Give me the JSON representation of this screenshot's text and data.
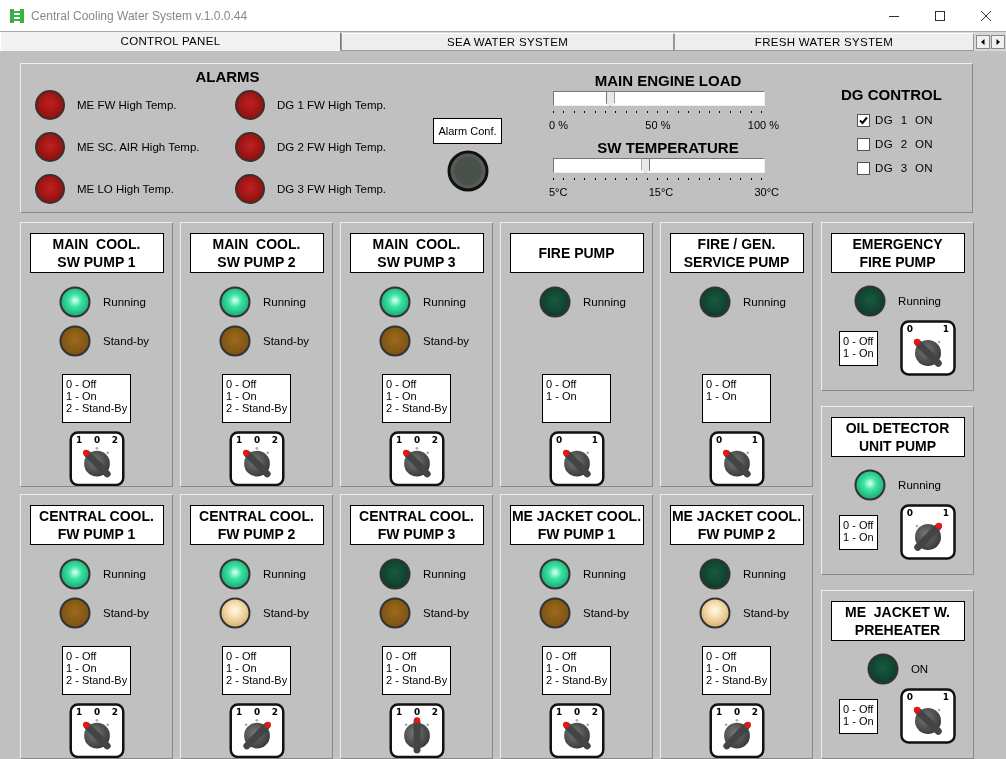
{
  "window": {
    "title": "Central Cooling Water System  v.1.0.0.44"
  },
  "tabs": [
    {
      "label": "CONTROL PANEL",
      "selected": true
    },
    {
      "label": "SEA WATER SYSTEM",
      "selected": false
    },
    {
      "label": "FRESH WATER SYSTEM",
      "selected": false
    }
  ],
  "alarms": {
    "title": "ALARMS",
    "items": [
      {
        "label": "ME FW  High Temp."
      },
      {
        "label": "ME SC. AIR High Temp."
      },
      {
        "label": "ME LO High Temp."
      },
      {
        "label": "DG 1 FW High Temp."
      },
      {
        "label": "DG 2 FW High Temp."
      },
      {
        "label": "DG 3 FW High Temp."
      }
    ],
    "confirm_label": "Alarm Conf."
  },
  "sliders": [
    {
      "title": "MAIN ENGINE LOAD",
      "level": 0.27,
      "scale": [
        "0 %",
        "50 %",
        "100 %"
      ]
    },
    {
      "title": "SW TEMPERATURE",
      "level": 0.44,
      "scale": [
        "5°C",
        "15°C",
        "30°C"
      ]
    }
  ],
  "dg_control": {
    "title": "DG CONTROL",
    "items": [
      {
        "label": "DG  1  ON",
        "checked": true
      },
      {
        "label": "DG  2  ON",
        "checked": false
      },
      {
        "label": "DG  3  ON",
        "checked": false
      }
    ]
  },
  "pumps": [
    {
      "title": "MAIN  COOL.\nSW PUMP 1",
      "lamps": [
        {
          "kind": "running",
          "label": "Running",
          "on": true
        },
        {
          "kind": "standby",
          "label": "Stand-by",
          "on": false
        }
      ],
      "legend": [
        "0 - Off",
        "1 - On",
        "2 - Stand-By"
      ],
      "positions": [
        {
          "label": "1",
          "selected": true
        },
        {
          "label": "0",
          "selected": false
        },
        {
          "label": "2",
          "selected": false
        }
      ]
    },
    {
      "title": "MAIN  COOL.\nSW PUMP 2",
      "lamps": [
        {
          "kind": "running",
          "label": "Running",
          "on": true
        },
        {
          "kind": "standby",
          "label": "Stand-by",
          "on": false
        }
      ],
      "legend": [
        "0 - Off",
        "1 - On",
        "2 - Stand-By"
      ],
      "positions": [
        {
          "label": "1",
          "selected": true
        },
        {
          "label": "0",
          "selected": false
        },
        {
          "label": "2",
          "selected": false
        }
      ]
    },
    {
      "title": "MAIN  COOL.\nSW PUMP 3",
      "lamps": [
        {
          "kind": "running",
          "label": "Running",
          "on": true
        },
        {
          "kind": "standby",
          "label": "Stand-by",
          "on": false
        }
      ],
      "legend": [
        "0 - Off",
        "1 - On",
        "2 - Stand-By"
      ],
      "positions": [
        {
          "label": "1",
          "selected": true
        },
        {
          "label": "0",
          "selected": false
        },
        {
          "label": "2",
          "selected": false
        }
      ]
    },
    {
      "title": "FIRE PUMP",
      "lamps": [
        {
          "kind": "running",
          "label": "Running",
          "on": false
        }
      ],
      "legend": [
        "0 - Off",
        "1 - On"
      ],
      "positions": [
        {
          "label": "0",
          "selected": true
        },
        {
          "label": "1",
          "selected": false
        }
      ]
    },
    {
      "title": "FIRE / GEN.\nSERVICE PUMP",
      "lamps": [
        {
          "kind": "running",
          "label": "Running",
          "on": false
        }
      ],
      "legend": [
        "0 - Off",
        "1 - On"
      ],
      "positions": [
        {
          "label": "0",
          "selected": true
        },
        {
          "label": "1",
          "selected": false
        }
      ]
    },
    {
      "title": "CENTRAL COOL.\nFW PUMP 1",
      "lamps": [
        {
          "kind": "running",
          "label": "Running",
          "on": true
        },
        {
          "kind": "standby",
          "label": "Stand-by",
          "on": false
        }
      ],
      "legend": [
        "0 - Off",
        "1 - On",
        "2 - Stand-By"
      ],
      "positions": [
        {
          "label": "1",
          "selected": true
        },
        {
          "label": "0",
          "selected": false
        },
        {
          "label": "2",
          "selected": false
        }
      ]
    },
    {
      "title": "CENTRAL COOL.\nFW PUMP 2",
      "lamps": [
        {
          "kind": "running",
          "label": "Running",
          "on": true
        },
        {
          "kind": "standby",
          "label": "Stand-by",
          "on": true
        }
      ],
      "legend": [
        "0 - Off",
        "1 - On",
        "2 - Stand-By"
      ],
      "positions": [
        {
          "label": "1",
          "selected": false
        },
        {
          "label": "0",
          "selected": false
        },
        {
          "label": "2",
          "selected": true
        }
      ]
    },
    {
      "title": "CENTRAL COOL.\nFW PUMP 3",
      "lamps": [
        {
          "kind": "running",
          "label": "Running",
          "on": false
        },
        {
          "kind": "standby",
          "label": "Stand-by",
          "on": false
        }
      ],
      "legend": [
        "0 - Off",
        "1 - On",
        "2 - Stand-By"
      ],
      "positions": [
        {
          "label": "1",
          "selected": false
        },
        {
          "label": "0",
          "selected": true
        },
        {
          "label": "2",
          "selected": false
        }
      ]
    },
    {
      "title": "ME JACKET COOL.\nFW PUMP 1",
      "lamps": [
        {
          "kind": "running",
          "label": "Running",
          "on": true
        },
        {
          "kind": "standby",
          "label": "Stand-by",
          "on": false
        }
      ],
      "legend": [
        "0 - Off",
        "1 - On",
        "2 - Stand-By"
      ],
      "positions": [
        {
          "label": "1",
          "selected": true
        },
        {
          "label": "0",
          "selected": false
        },
        {
          "label": "2",
          "selected": false
        }
      ]
    },
    {
      "title": "ME JACKET COOL.\nFW PUMP 2",
      "lamps": [
        {
          "kind": "running",
          "label": "Running",
          "on": false
        },
        {
          "kind": "standby",
          "label": "Stand-by",
          "on": true
        }
      ],
      "legend": [
        "0 - Off",
        "1 - On",
        "2 - Stand-By"
      ],
      "positions": [
        {
          "label": "1",
          "selected": false
        },
        {
          "label": "0",
          "selected": false
        },
        {
          "label": "2",
          "selected": true
        }
      ]
    }
  ],
  "side_units": [
    {
      "title": "EMERGENCY\nFIRE PUMP",
      "lamp": {
        "kind": "running",
        "label": "Running",
        "on": false
      },
      "legend": [
        "0 - Off",
        "1 - On"
      ],
      "positions": [
        {
          "label": "0",
          "selected": true
        },
        {
          "label": "1",
          "selected": false
        }
      ]
    },
    {
      "title": "OIL DETECTOR\nUNIT PUMP",
      "lamp": {
        "kind": "running",
        "label": "Running",
        "on": true
      },
      "legend": [
        "0 - Off",
        "1 - On"
      ],
      "positions": [
        {
          "label": "0",
          "selected": false
        },
        {
          "label": "1",
          "selected": true
        }
      ]
    },
    {
      "title": "ME  JACKET W.\nPREHEATER",
      "lamp": {
        "kind": "running",
        "label": "ON",
        "on": false
      },
      "legend": [
        "0 - Off",
        "1 - On"
      ],
      "positions": [
        {
          "label": "0",
          "selected": true
        },
        {
          "label": "1",
          "selected": false
        }
      ]
    }
  ]
}
